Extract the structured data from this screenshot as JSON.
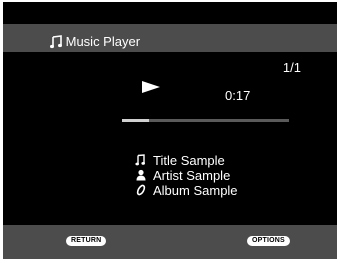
{
  "header": {
    "title": "Music Player",
    "icon": "music-note-icon"
  },
  "playback": {
    "track_index": "1/1",
    "state_icon": "play-icon",
    "elapsed": "0:17",
    "progress_fraction": 0.16
  },
  "track": {
    "title": "Title Sample",
    "artist": "Artist Sample",
    "album": "Album Sample"
  },
  "footer": {
    "return_label": "RETURN",
    "options_label": "OPTIONS"
  },
  "colors": {
    "screen_bg": "#000000",
    "bar_bg": "#4c4c4c",
    "progress_fill": "#d0d0d0",
    "progress_track": "#5a5a5a"
  }
}
